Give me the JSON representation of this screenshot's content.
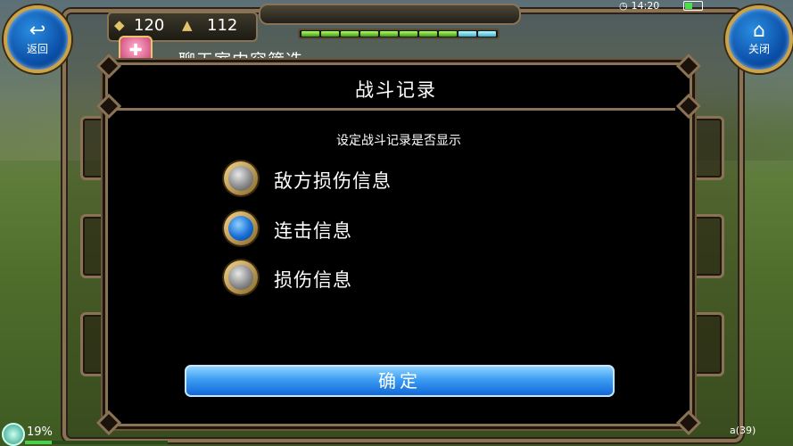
{
  "top_bar": {
    "gems_value": "120",
    "rank_value": "112",
    "experience_segments": 10,
    "experience_filled": 10
  },
  "nav": {
    "back_label": "返回",
    "home_label": "关闭"
  },
  "background": {
    "section_title": "聊天室内容筛选"
  },
  "status": {
    "time": "14:20",
    "loading_percent": "19%",
    "loading_fraction": 0.19,
    "right_text": "a(39)"
  },
  "dialog": {
    "title": "战斗记录",
    "subtitle": "设定战斗记录是否显示",
    "options": [
      {
        "label": "敌方损伤信息",
        "selected": false
      },
      {
        "label": "连击信息",
        "selected": true
      },
      {
        "label": "损伤信息",
        "selected": false
      }
    ],
    "confirm_label": "确定"
  },
  "colors": {
    "frame": "#8a7355",
    "accent_blue": "#1a6fd6",
    "dialog_bg": "#000000"
  }
}
